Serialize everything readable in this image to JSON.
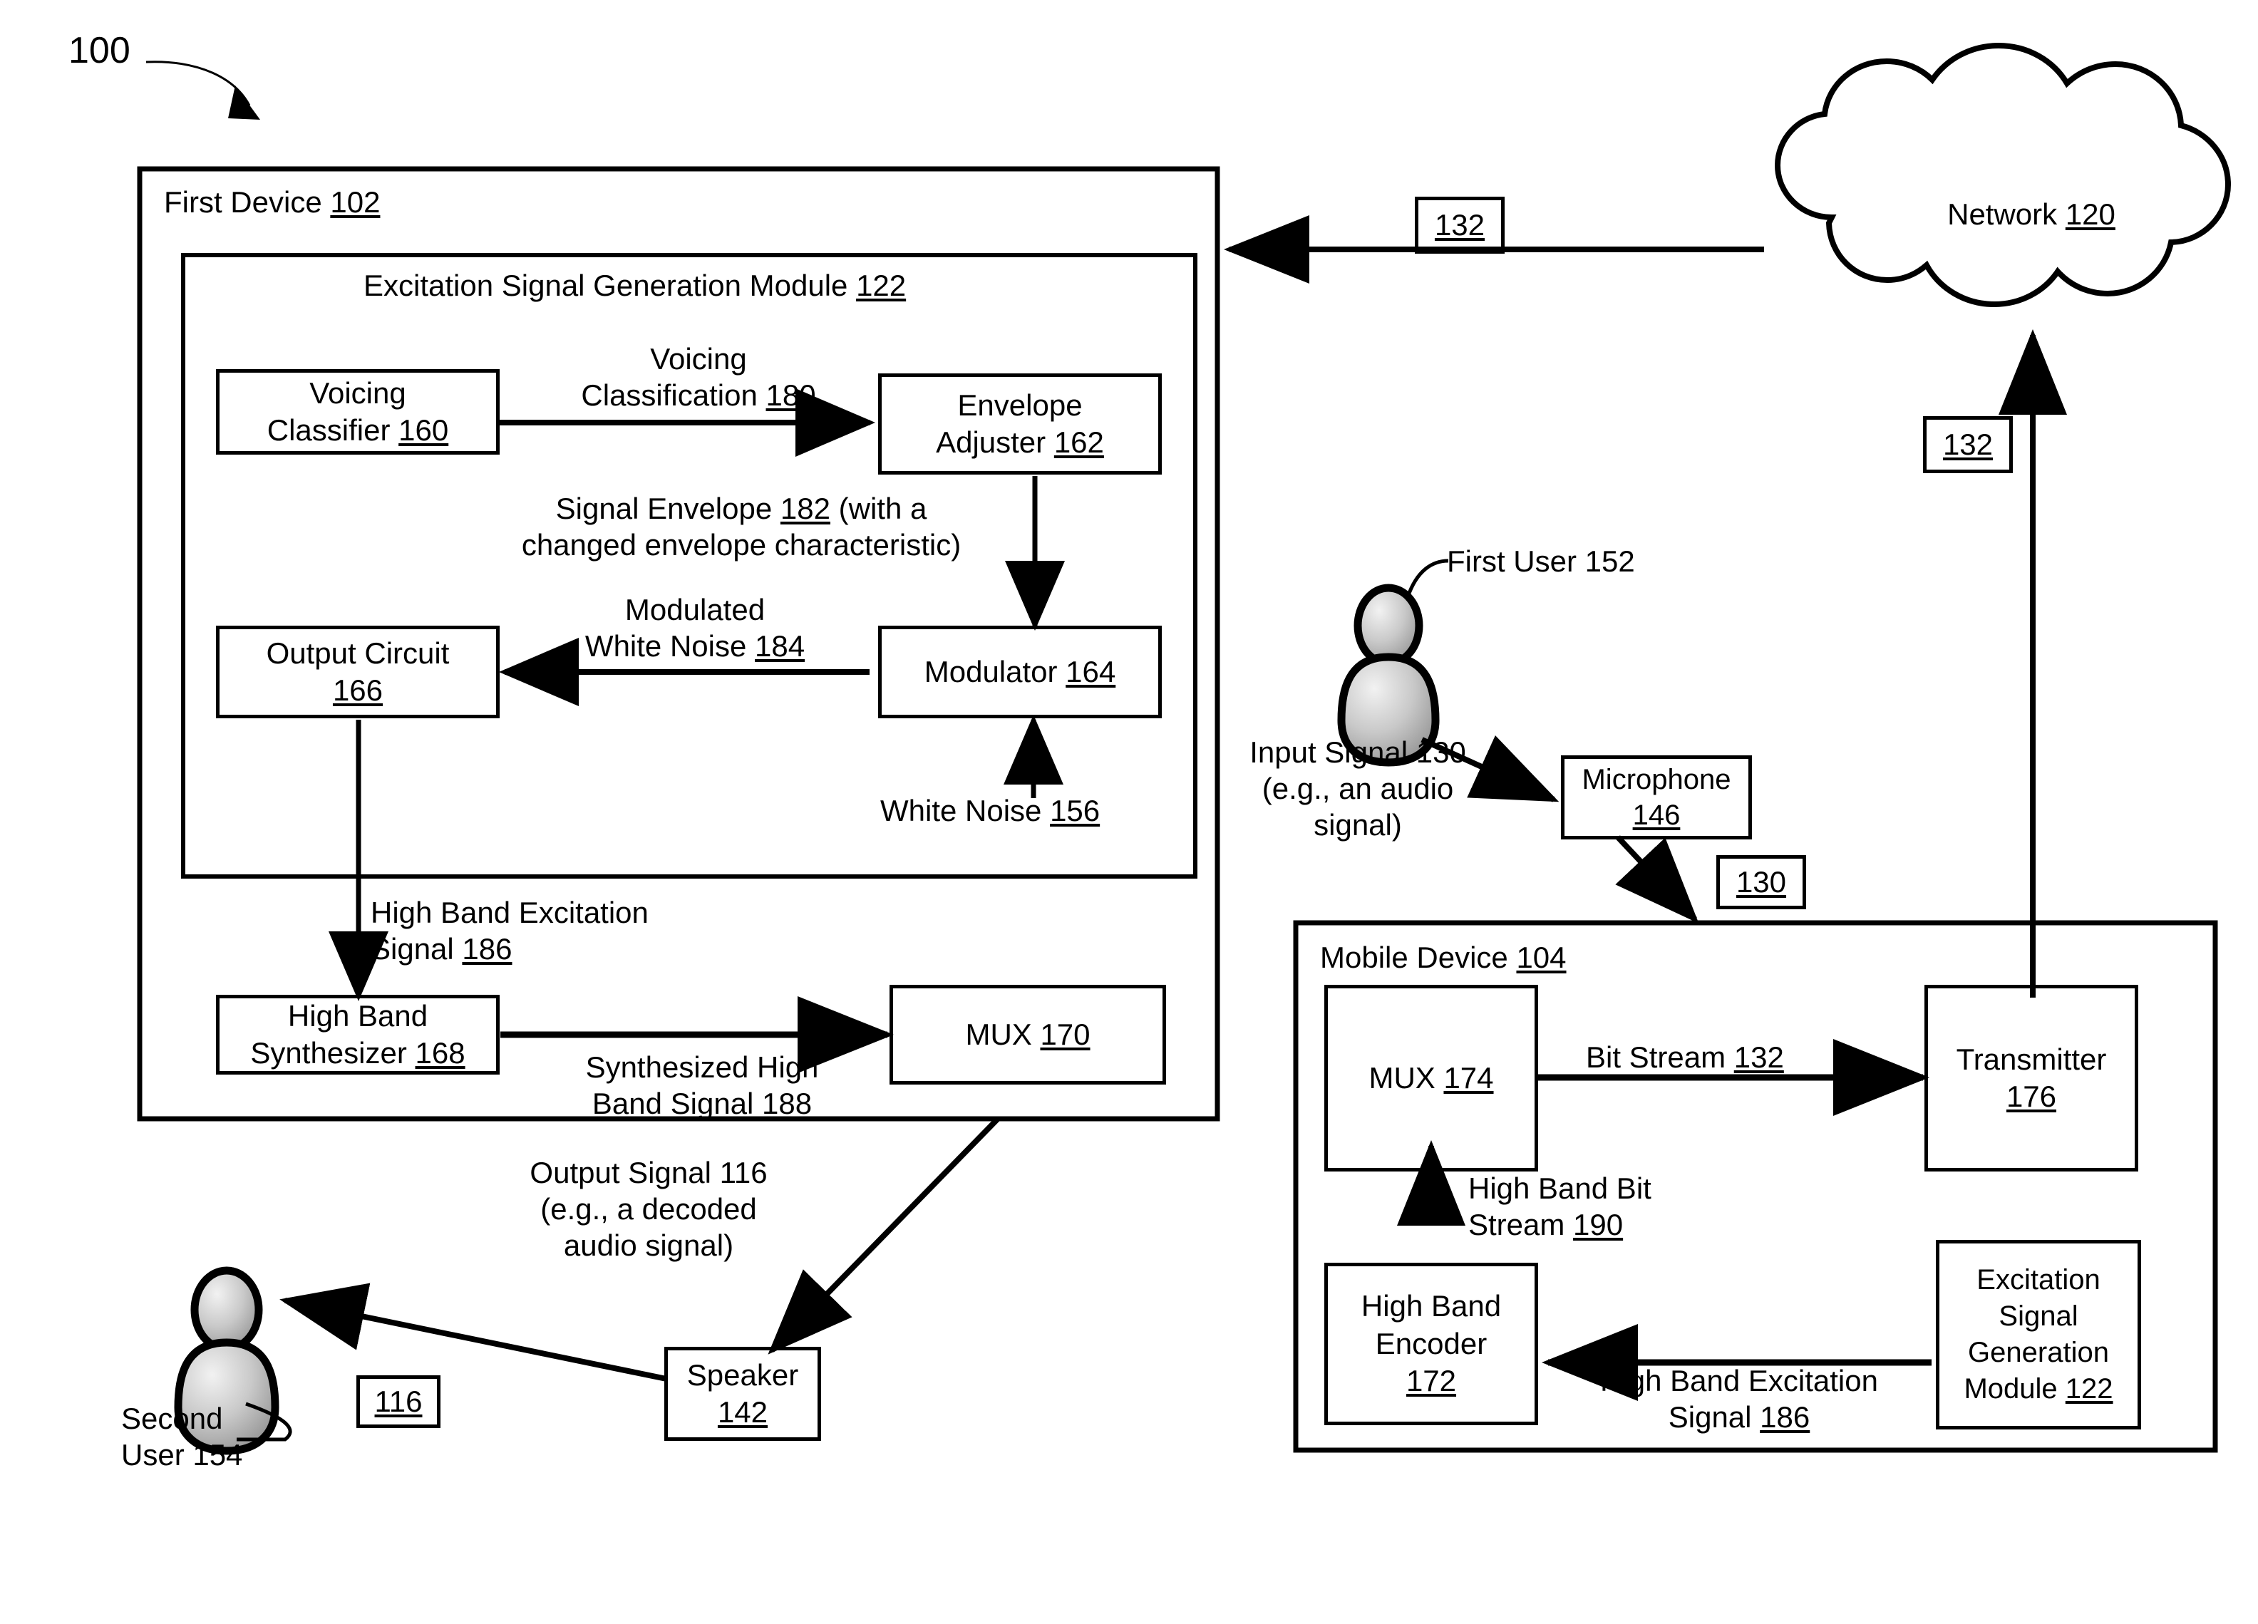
{
  "figure": {
    "figure_number": "100"
  },
  "first_device": {
    "title": "First Device ",
    "ref": "102",
    "module": {
      "title": "Excitation Signal Generation Module ",
      "ref": "122",
      "blocks": {
        "voicing_classifier": {
          "line1": "Voicing",
          "line2": "Classifier ",
          "ref": "160"
        },
        "envelope_adjuster": {
          "line1": "Envelope",
          "line2": "Adjuster ",
          "ref": "162"
        },
        "output_circuit": {
          "line1": "Output Circuit",
          "line2": "",
          "ref": "166"
        },
        "modulator": {
          "line1": "Modulator ",
          "line2": "",
          "ref": "164"
        }
      },
      "signals": {
        "voicing_classification": {
          "line1": "Voicing",
          "line2": "Classification ",
          "ref": "180"
        },
        "signal_envelope": {
          "line1": "Signal Envelope ",
          "ref": "182",
          "line1_tail": " (with a",
          "line2": "changed envelope characteristic)"
        },
        "modulated_white_noise": {
          "line1": "Modulated",
          "line2": "White Noise ",
          "ref": "184"
        },
        "white_noise": {
          "text": "White Noise ",
          "ref": "156"
        }
      }
    },
    "high_band_excitation_signal": {
      "line1": "High Band Excitation",
      "line2": "Signal ",
      "ref": "186"
    },
    "high_band_synthesizer": {
      "line1": "High Band",
      "line2": "Synthesizer ",
      "ref": "168"
    },
    "synthesized_high_band_signal": {
      "line1": "Synthesized High",
      "line2": "Band Signal ",
      "ref": "188"
    },
    "mux": {
      "label": "MUX ",
      "ref": "170"
    }
  },
  "output_path": {
    "output_signal": {
      "line1": "Output Signal 116",
      "line2": "(e.g., a decoded",
      "line3": "audio signal)"
    },
    "speaker": {
      "line1": "Speaker",
      "ref": "142"
    },
    "tag_116": "116",
    "second_user": {
      "line1": "Second",
      "line2": "User 154"
    }
  },
  "network": {
    "label": "Network ",
    "ref": "120",
    "tag_upper": "132",
    "tag_lower": "132"
  },
  "capture": {
    "first_user": "First User 152",
    "input_signal": {
      "line1": "Input Signal 130",
      "line2": "(e.g., an audio",
      "line3": "signal)"
    },
    "microphone": {
      "line1": "Microphone",
      "ref": "146"
    },
    "tag_130": "130"
  },
  "mobile_device": {
    "title": "Mobile Device ",
    "ref": "104",
    "mux": {
      "label": "MUX ",
      "ref": "174"
    },
    "bit_stream": {
      "label": "Bit Stream ",
      "ref": "132"
    },
    "transmitter": {
      "line1": "Transmitter",
      "ref": "176"
    },
    "high_band_bit_stream": {
      "line1": "High Band Bit",
      "line2": "Stream ",
      "ref": "190"
    },
    "high_band_encoder": {
      "line1": "High Band",
      "line2": "Encoder",
      "ref": "172"
    },
    "high_band_excitation_signal": {
      "line1": "High Band Excitation",
      "line2": "Signal ",
      "ref": "186"
    },
    "excitation_module": {
      "line1": "Excitation",
      "line2": "Signal",
      "line3": "Generation",
      "line4": "Module ",
      "ref": "122"
    }
  }
}
